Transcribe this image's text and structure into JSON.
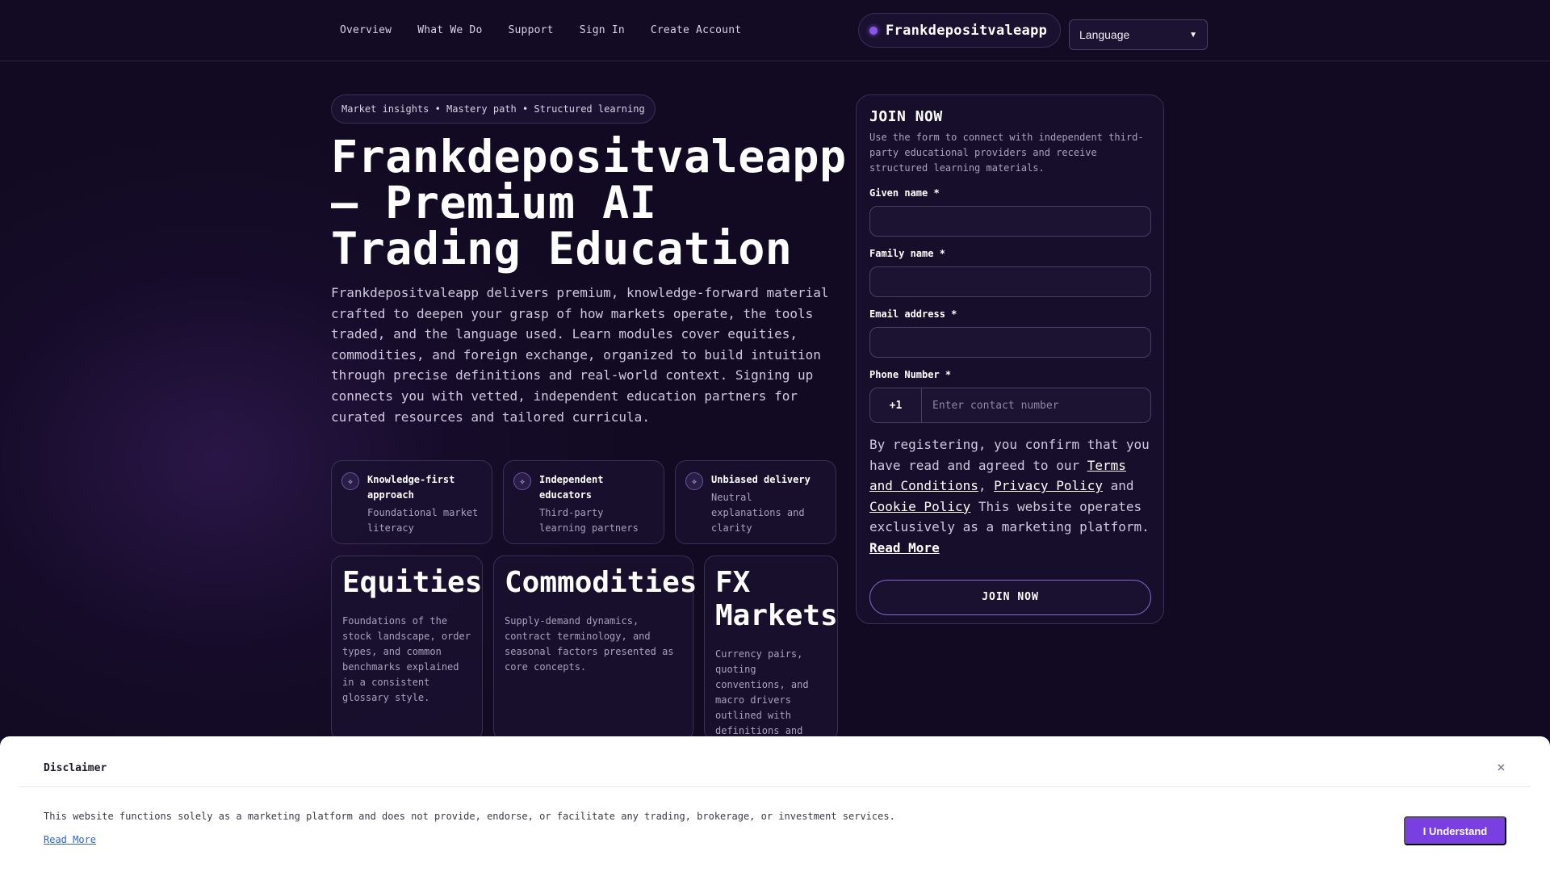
{
  "nav": {
    "links": [
      "Overview",
      "What We Do",
      "Support",
      "Sign In",
      "Create Account"
    ],
    "brand": "Frankdepositvaleapp",
    "language": "Language"
  },
  "hero": {
    "tagline": "Market insights • Mastery path • Structured learning",
    "title": "Frankdepositvaleapp – Premium AI Trading Education",
    "description": "Frankdepositvaleapp delivers premium, knowledge-forward material crafted to deepen your grasp of how markets operate, the tools traded, and the language used. Learn modules cover equities, commodities, and foreign exchange, organized to build intuition through precise definitions and real-world context. Signing up connects you with vetted, independent education partners for curated resources and tailored curricula."
  },
  "features": [
    {
      "icon": "sparkle-icon",
      "title": "Knowledge-first approach",
      "subtitle": "Foundational market literacy"
    },
    {
      "icon": "sparkle-icon",
      "title": "Independent educators",
      "subtitle": "Third-party learning partners"
    },
    {
      "icon": "sparkle-icon",
      "title": "Unbiased delivery",
      "subtitle": "Neutral explanations and clarity"
    }
  ],
  "markets": [
    {
      "title": "Equities",
      "description": "Foundations of the stock landscape, order types, and common benchmarks explained in a consistent glossary style."
    },
    {
      "title": "Commodities",
      "description": "Supply-demand dynamics, contract terminology, and seasonal factors presented as core concepts."
    },
    {
      "title": "FX Markets",
      "description": "Currency pairs, quoting conventions, and macro drivers outlined with definitions and examples."
    }
  ],
  "form": {
    "title": "JOIN NOW",
    "description": "Use the form to connect with independent third-party educational providers and receive structured learning materials.",
    "given_name_label": "Given name *",
    "family_name_label": "Family name *",
    "email_label": "Email address *",
    "phone_label": "Phone Number *",
    "phone_code": "+1",
    "phone_placeholder": "Enter contact number",
    "consent_pre": "By registering, you confirm that you have read and agreed to our ",
    "terms_link": "Terms and Conditions",
    "comma": ", ",
    "privacy_link": "Privacy Policy",
    "and": " and ",
    "cookie_link": "Cookie Policy",
    "consent_post": " This website operates exclusively as a marketing platform. ",
    "read_more": "Read More",
    "submit": "JOIN NOW"
  },
  "disclaimer": {
    "title": "Disclaimer",
    "close": "×",
    "text": "This website functions solely as a marketing platform and does not provide, endorse, or facilitate any trading, brokerage, or investment services.",
    "read_more": "Read More",
    "button": "I Understand"
  }
}
